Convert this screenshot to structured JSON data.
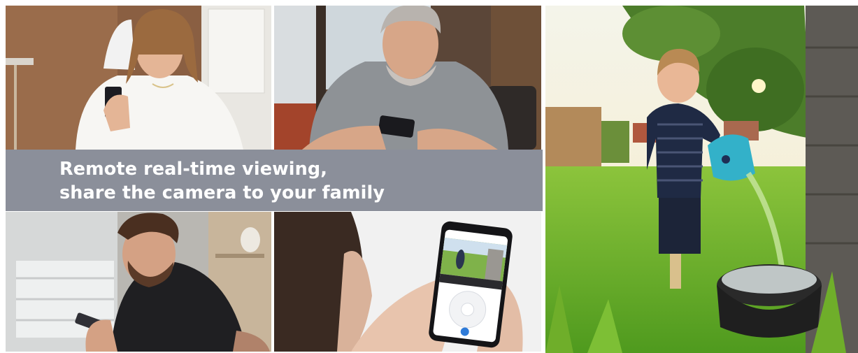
{
  "banner": {
    "line1": "Remote real-time viewing,",
    "line2": "share the camera to your family"
  },
  "tiles": [
    {
      "id": "woman-with-phone",
      "subject": "woman in white shirt using smartphone"
    },
    {
      "id": "older-man-with-phone",
      "subject": "older man in grey shirt using smartphone"
    },
    {
      "id": "young-man-with-phone",
      "subject": "smiling man in black t-shirt with phone"
    },
    {
      "id": "hands-holding-app",
      "subject": "hands holding smartphone showing camera app"
    },
    {
      "id": "child-watering",
      "subject": "boy watering garden with blue watering can"
    }
  ],
  "colors": {
    "banner_bg": "#8b8f9a",
    "banner_text": "#ffffff",
    "grass": "#6fae2a",
    "app_accent": "#2f7bd8"
  }
}
